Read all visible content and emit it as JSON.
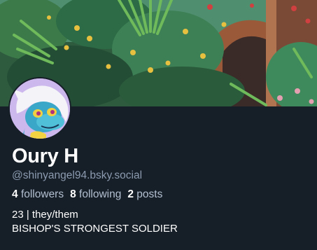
{
  "profile": {
    "display_name": "Oury H",
    "handle": "@shinyangel94.bsky.social",
    "stats": {
      "followers_count": "4",
      "followers_label": "followers",
      "following_count": "8",
      "following_label": "following",
      "posts_count": "2",
      "posts_label": "posts"
    },
    "bio_lines": [
      "23 | they/them",
      "BISHOP'S STRONGEST SOLDIER"
    ]
  },
  "colors": {
    "background": "#161e27",
    "handle_text": "#8c9bb0",
    "primary_text": "#ffffff"
  }
}
